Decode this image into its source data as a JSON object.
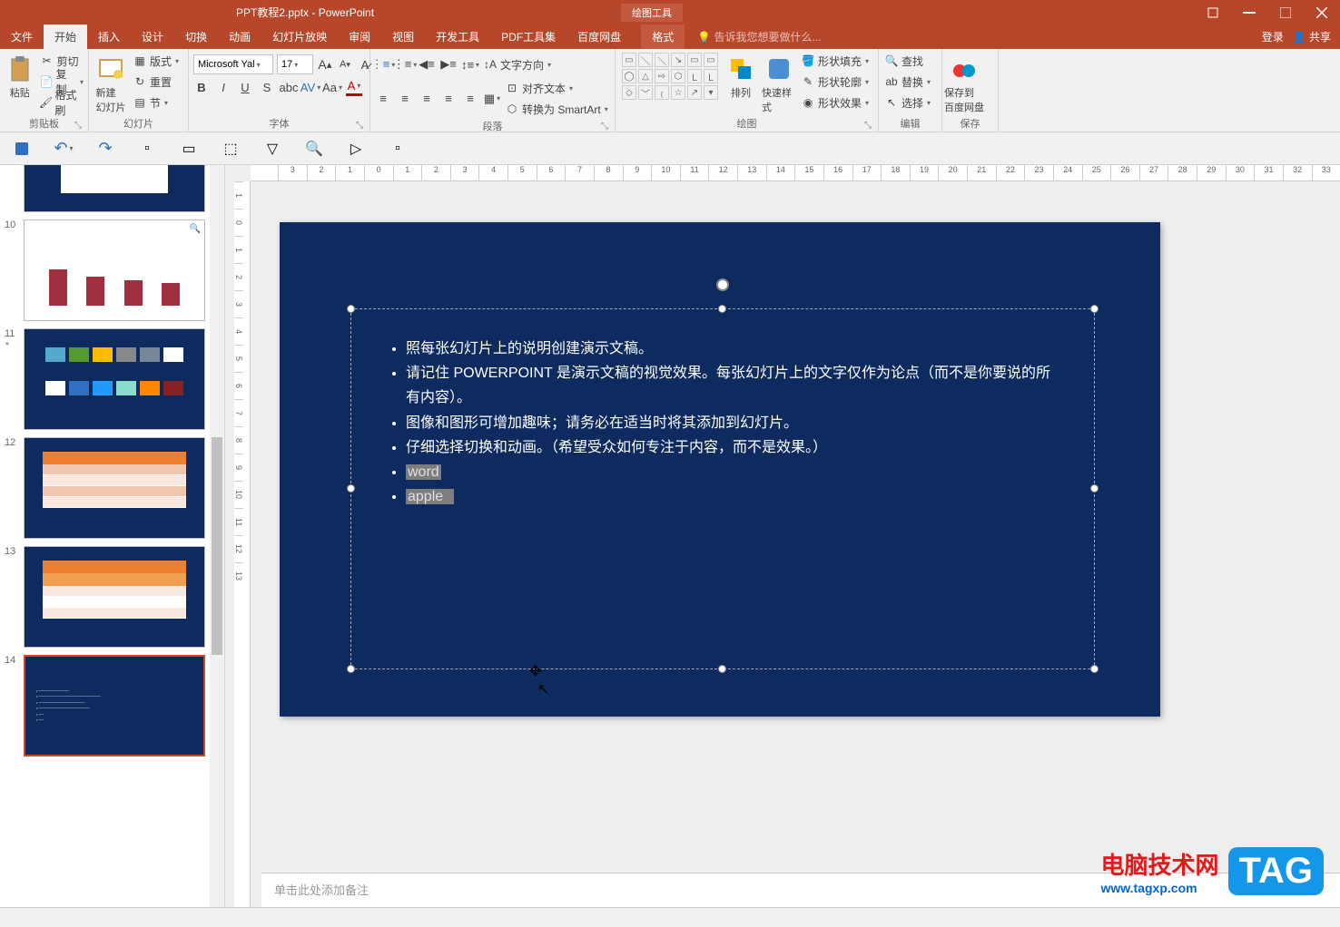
{
  "titlebar": {
    "filename": "PPT教程2.pptx - PowerPoint",
    "tools": "绘图工具"
  },
  "window_buttons": {
    "login": "登录",
    "share": "共享"
  },
  "tabs": {
    "file": "文件",
    "home": "开始",
    "insert": "插入",
    "design": "设计",
    "transitions": "切换",
    "animations": "动画",
    "slideshow": "幻灯片放映",
    "review": "审阅",
    "view": "视图",
    "developer": "开发工具",
    "pdf": "PDF工具集",
    "baidu": "百度网盘",
    "format": "格式"
  },
  "tellme": "告诉我您想要做什么...",
  "clipboard": {
    "paste": "粘贴",
    "cut": "剪切",
    "copy": "复制",
    "formatpainter": "格式刷",
    "label": "剪贴板"
  },
  "slides": {
    "new": "新建\n幻灯片",
    "layout": "版式",
    "reset": "重置",
    "section": "节",
    "label": "幻灯片"
  },
  "font": {
    "name": "Microsoft Yal",
    "size": "17",
    "label": "字体"
  },
  "paragraph": {
    "textdir": "文字方向",
    "align": "对齐文本",
    "smartart": "转换为 SmartArt",
    "label": "段落"
  },
  "drawing": {
    "arrange": "排列",
    "quickstyle": "快速样式",
    "shapefill": "形状填充",
    "shapeoutline": "形状轮廓",
    "shapeeffects": "形状效果",
    "label": "绘图"
  },
  "editing": {
    "find": "查找",
    "replace": "替换",
    "select": "选择",
    "label": "编辑"
  },
  "save_cloud": {
    "save": "保存到\n百度网盘",
    "label": "保存"
  },
  "thumbs": [
    {
      "num": "10"
    },
    {
      "num": "11",
      "star": "*"
    },
    {
      "num": "12"
    },
    {
      "num": "13"
    },
    {
      "num": "14"
    }
  ],
  "slide_content": {
    "bullets": [
      "照每张幻灯片上的说明创建演示文稿。",
      "请记住 POWERPOINT 是演示文稿的视觉效果。每张幻灯片上的文字仅作为论点（而不是你要说的所有内容）。",
      "图像和图形可增加趣味；请务必在适当时将其添加到幻灯片。",
      "仔细选择切换和动画。（希望受众如何专注于内容，而不是效果。）"
    ],
    "sel1": "word",
    "sel2": "apple"
  },
  "notes": "单击此处添加备注",
  "ruler_h": [
    "3",
    "2",
    "1",
    "0",
    "1",
    "2",
    "3",
    "4",
    "5",
    "6",
    "7",
    "8",
    "9",
    "10",
    "11",
    "12",
    "13",
    "14",
    "15",
    "16",
    "17",
    "18",
    "19",
    "20",
    "21",
    "22",
    "23",
    "24",
    "25",
    "26",
    "27",
    "28",
    "29",
    "30",
    "31",
    "32",
    "33"
  ],
  "ruler_v": [
    "1",
    "0",
    "1",
    "2",
    "3",
    "4",
    "5",
    "6",
    "7",
    "8",
    "9",
    "10",
    "11",
    "12",
    "13"
  ],
  "watermark": {
    "t1": "电脑技术网",
    "t2": "www.tagxp.com",
    "tag": "TAG"
  }
}
